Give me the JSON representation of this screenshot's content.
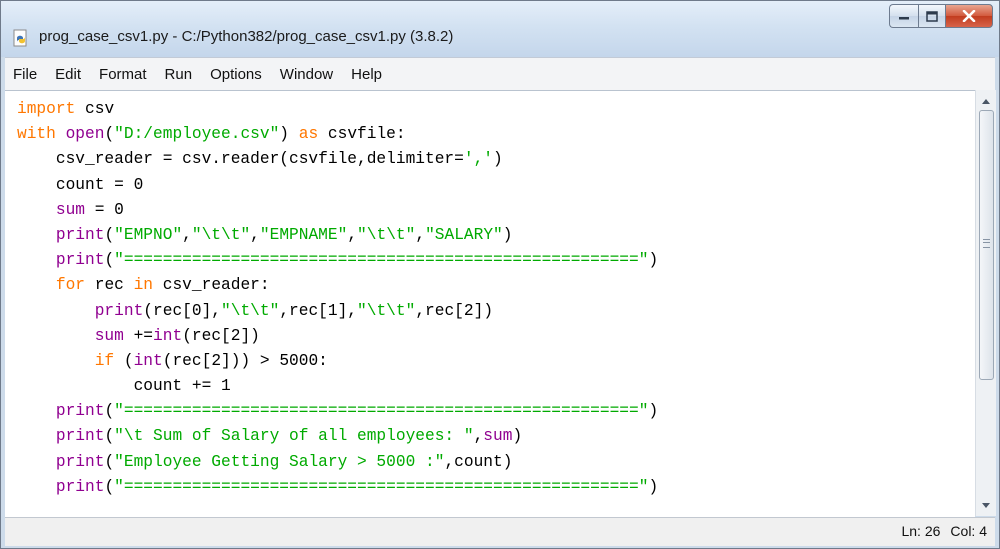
{
  "window": {
    "title": "prog_case_csv1.py - C:/Python382/prog_case_csv1.py (3.8.2)",
    "icon": "python-file-icon",
    "controls": [
      "minimize-icon",
      "maximize-icon",
      "close-icon"
    ]
  },
  "menu": [
    "File",
    "Edit",
    "Format",
    "Run",
    "Options",
    "Window",
    "Help"
  ],
  "colors": {
    "keyword": "#ff7700",
    "string": "#00aa00",
    "builtin": "#900090",
    "text": "#000000",
    "close_button": "#c7442a"
  },
  "code_lines": [
    [
      [
        "kw",
        "import"
      ],
      [
        "plain",
        " csv"
      ]
    ],
    [
      [
        "kw",
        "with"
      ],
      [
        "plain",
        " "
      ],
      [
        "bi",
        "open"
      ],
      [
        "plain",
        "("
      ],
      [
        "str",
        "\"D:/employee.csv\""
      ],
      [
        "plain",
        ") "
      ],
      [
        "kw",
        "as"
      ],
      [
        "plain",
        " csvfile:"
      ]
    ],
    [
      [
        "plain",
        "    csv_reader = csv.reader(csvfile,delimiter="
      ],
      [
        "str",
        "','"
      ],
      [
        "plain",
        ")"
      ]
    ],
    [
      [
        "plain",
        "    count = 0"
      ]
    ],
    [
      [
        "plain",
        "    "
      ],
      [
        "bi",
        "sum"
      ],
      [
        "plain",
        " = 0"
      ]
    ],
    [
      [
        "plain",
        "    "
      ],
      [
        "bi",
        "print"
      ],
      [
        "plain",
        "("
      ],
      [
        "str",
        "\"EMPNO\""
      ],
      [
        "plain",
        ","
      ],
      [
        "str",
        "\"\\t\\t\""
      ],
      [
        "plain",
        ","
      ],
      [
        "str",
        "\"EMPNAME\""
      ],
      [
        "plain",
        ","
      ],
      [
        "str",
        "\"\\t\\t\""
      ],
      [
        "plain",
        ","
      ],
      [
        "str",
        "\"SALARY\""
      ],
      [
        "plain",
        ")"
      ]
    ],
    [
      [
        "plain",
        "    "
      ],
      [
        "bi",
        "print"
      ],
      [
        "plain",
        "("
      ],
      [
        "str",
        "\"=====================================================\""
      ],
      [
        "plain",
        ")"
      ]
    ],
    [
      [
        "plain",
        "    "
      ],
      [
        "kw",
        "for"
      ],
      [
        "plain",
        " rec "
      ],
      [
        "kw",
        "in"
      ],
      [
        "plain",
        " csv_reader:"
      ]
    ],
    [
      [
        "plain",
        "        "
      ],
      [
        "bi",
        "print"
      ],
      [
        "plain",
        "(rec[0],"
      ],
      [
        "str",
        "\"\\t\\t\""
      ],
      [
        "plain",
        ",rec[1],"
      ],
      [
        "str",
        "\"\\t\\t\""
      ],
      [
        "plain",
        ",rec[2])"
      ]
    ],
    [
      [
        "plain",
        "        "
      ],
      [
        "bi",
        "sum"
      ],
      [
        "plain",
        " +="
      ],
      [
        "bi",
        "int"
      ],
      [
        "plain",
        "(rec[2])"
      ]
    ],
    [
      [
        "plain",
        "        "
      ],
      [
        "kw",
        "if"
      ],
      [
        "plain",
        " ("
      ],
      [
        "bi",
        "int"
      ],
      [
        "plain",
        "(rec[2])) > 5000:"
      ]
    ],
    [
      [
        "plain",
        "            count += 1"
      ]
    ],
    [
      [
        "plain",
        "    "
      ],
      [
        "bi",
        "print"
      ],
      [
        "plain",
        "("
      ],
      [
        "str",
        "\"=====================================================\""
      ],
      [
        "plain",
        ")"
      ]
    ],
    [
      [
        "plain",
        "    "
      ],
      [
        "bi",
        "print"
      ],
      [
        "plain",
        "("
      ],
      [
        "str",
        "\"\\t Sum of Salary of all employees: \""
      ],
      [
        "plain",
        ","
      ],
      [
        "bi",
        "sum"
      ],
      [
        "plain",
        ")"
      ]
    ],
    [
      [
        "plain",
        "    "
      ],
      [
        "bi",
        "print"
      ],
      [
        "plain",
        "("
      ],
      [
        "str",
        "\"Employee Getting Salary > 5000 :\""
      ],
      [
        "plain",
        ",count)"
      ]
    ],
    [
      [
        "plain",
        "    "
      ],
      [
        "bi",
        "print"
      ],
      [
        "plain",
        "("
      ],
      [
        "str",
        "\"=====================================================\""
      ],
      [
        "plain",
        ")"
      ]
    ]
  ],
  "status": {
    "line": "Ln: 26",
    "col": "Col: 4"
  }
}
